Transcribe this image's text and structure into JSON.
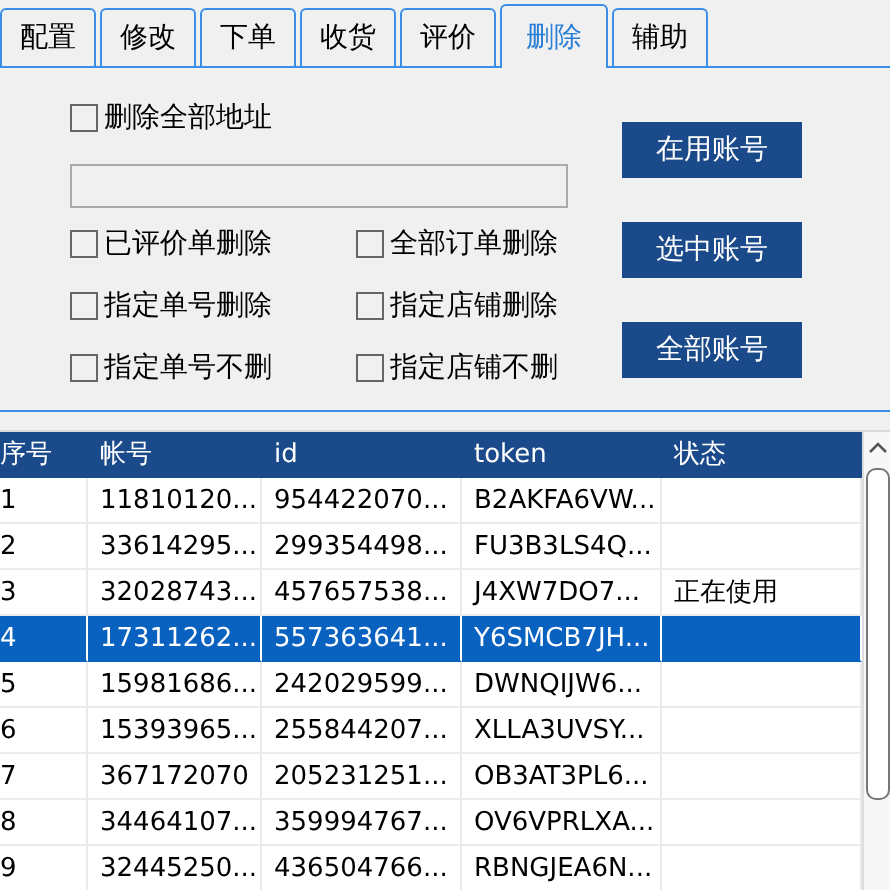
{
  "tabs": [
    {
      "label": "配置",
      "selected": false
    },
    {
      "label": "修改",
      "selected": false
    },
    {
      "label": "下单",
      "selected": false
    },
    {
      "label": "收货",
      "selected": false
    },
    {
      "label": "评价",
      "selected": false
    },
    {
      "label": "删除",
      "selected": true
    },
    {
      "label": "辅助",
      "selected": false
    }
  ],
  "delete_all_address": {
    "label": "删除全部地址",
    "checked": false
  },
  "options": [
    {
      "label": "已评价单删除",
      "checked": false
    },
    {
      "label": "全部订单删除",
      "checked": false
    },
    {
      "label": "指定单号删除",
      "checked": false
    },
    {
      "label": "指定店铺删除",
      "checked": false
    },
    {
      "label": "指定单号不删",
      "checked": false
    },
    {
      "label": "指定店铺不删",
      "checked": false
    }
  ],
  "buttons": [
    "在用账号",
    "选中账号",
    "全部账号"
  ],
  "table": {
    "columns": [
      "序号",
      "帐号",
      "id",
      "token",
      "状态"
    ],
    "rows": [
      {
        "selected": false,
        "cells": [
          "1",
          "11810120...",
          "954422070...",
          "B2AKFA6VW...",
          ""
        ]
      },
      {
        "selected": false,
        "cells": [
          "2",
          "33614295...",
          "299354498...",
          "FU3B3LS4Q...",
          ""
        ]
      },
      {
        "selected": false,
        "cells": [
          "3",
          "32028743...",
          "457657538...",
          "J4XW7DO7...",
          "正在使用"
        ]
      },
      {
        "selected": true,
        "cells": [
          "4",
          "17311262...",
          "557363641...",
          "Y6SMCB7JH...",
          ""
        ]
      },
      {
        "selected": false,
        "cells": [
          "5",
          "15981686...",
          "242029599...",
          "DWNQIJW6...",
          ""
        ]
      },
      {
        "selected": false,
        "cells": [
          "6",
          "15393965...",
          "255844207...",
          "XLLA3UVSY...",
          ""
        ]
      },
      {
        "selected": false,
        "cells": [
          "7",
          "367172070",
          "205231251...",
          "OB3AT3PL6...",
          ""
        ]
      },
      {
        "selected": false,
        "cells": [
          "8",
          "34464107...",
          "359994767...",
          "OV6VPRLXA...",
          ""
        ]
      },
      {
        "selected": false,
        "cells": [
          "9",
          "32445250...",
          "436504766...",
          "RBNGJEA6N...",
          ""
        ]
      }
    ]
  }
}
